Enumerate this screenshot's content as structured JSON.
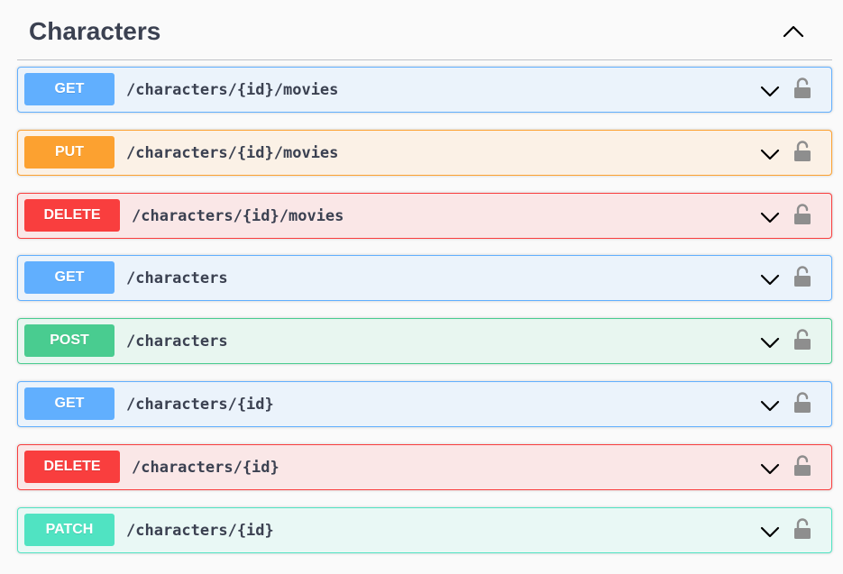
{
  "section": {
    "title": "Characters"
  },
  "operations": [
    {
      "method": "GET",
      "path": "/characters/{id}/movies"
    },
    {
      "method": "PUT",
      "path": "/characters/{id}/movies"
    },
    {
      "method": "DELETE",
      "path": "/characters/{id}/movies"
    },
    {
      "method": "GET",
      "path": "/characters"
    },
    {
      "method": "POST",
      "path": "/characters"
    },
    {
      "method": "GET",
      "path": "/characters/{id}"
    },
    {
      "method": "DELETE",
      "path": "/characters/{id}"
    },
    {
      "method": "PATCH",
      "path": "/characters/{id}"
    }
  ],
  "icons": {
    "collapse": "chevron-up-icon",
    "expand": "chevron-down-icon",
    "auth": "lock-open-icon"
  },
  "colors": {
    "get": "#61affe",
    "put": "#fca130",
    "delete": "#f93e3e",
    "post": "#49cc90",
    "patch": "#50e3c2"
  }
}
